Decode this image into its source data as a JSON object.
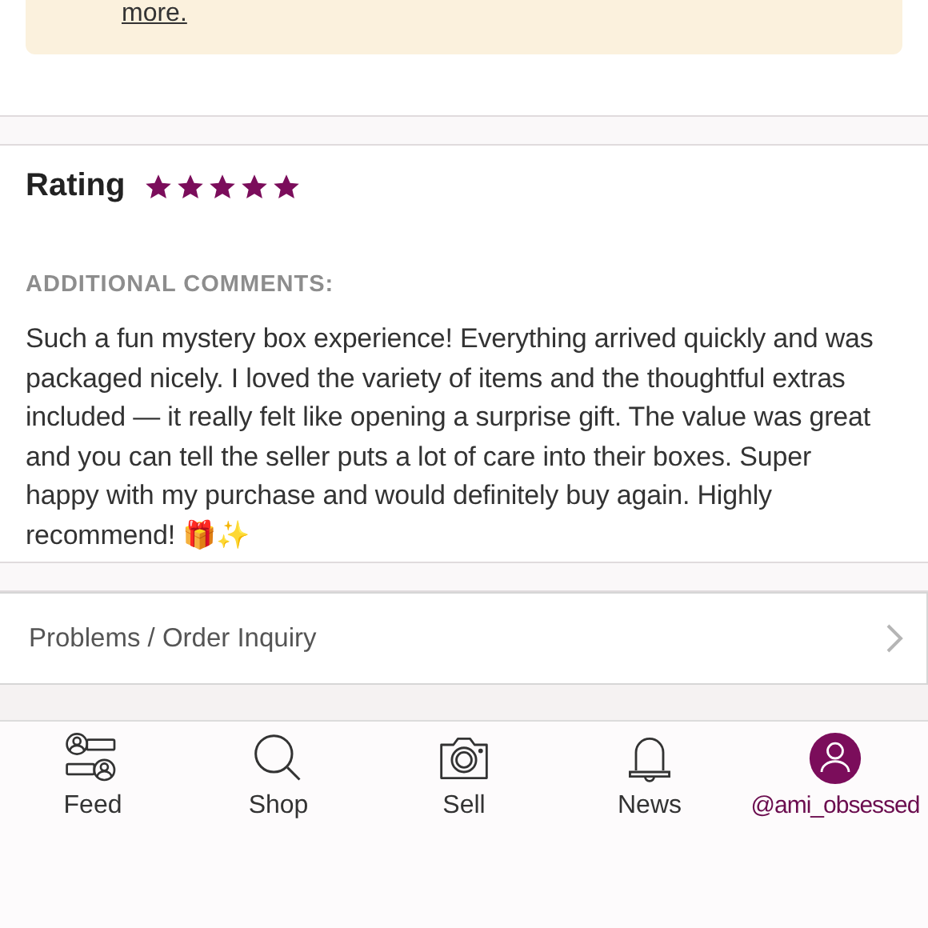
{
  "notice": {
    "link": "more."
  },
  "rating": {
    "label": "Rating",
    "stars": 5
  },
  "comments": {
    "heading": "ADDITIONAL COMMENTS:",
    "text": "Such a fun mystery box experience! Everything arrived quickly and was packaged nicely. I loved the variety of items and the thoughtful extras included — it really felt like opening a surprise gift. The value was great and you can tell the seller puts a lot of care into their boxes. Super happy with my purchase and would definitely buy again. Highly recommend! 🎁✨"
  },
  "inquiry": {
    "label": "Problems / Order Inquiry"
  },
  "tab_bar": [
    {
      "kind": "feed",
      "label": "Feed",
      "selected": false
    },
    {
      "kind": "shop",
      "label": "Shop",
      "selected": false
    },
    {
      "kind": "sell",
      "label": "Sell",
      "selected": false
    },
    {
      "kind": "news",
      "label": "News",
      "selected": false
    },
    {
      "kind": "profile",
      "label": "@ami_obsessed",
      "selected": true
    }
  ]
}
